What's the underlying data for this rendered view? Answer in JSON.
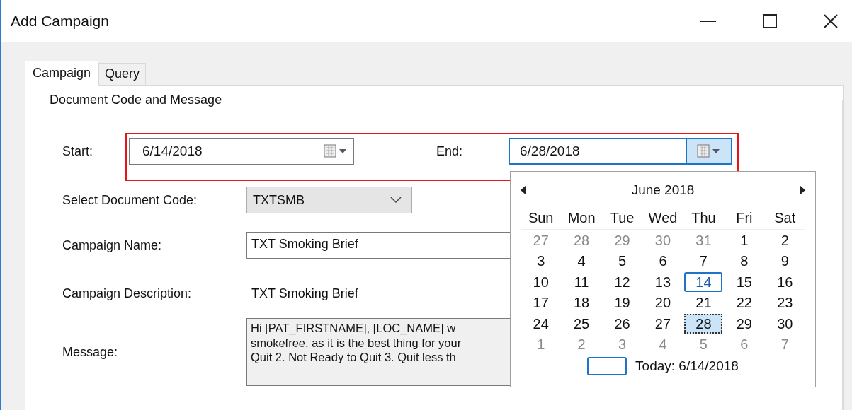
{
  "window": {
    "title": "Add Campaign"
  },
  "tabs": [
    {
      "label": "Campaign",
      "selected": true
    },
    {
      "label": "Query",
      "selected": false
    }
  ],
  "group": {
    "title": "Document Code and Message"
  },
  "start": {
    "label": "Start:",
    "value": "6/14/2018"
  },
  "end": {
    "label": "End:",
    "value": "6/28/2018",
    "dropdown_open": true
  },
  "document_code": {
    "label": "Select Document Code:",
    "value": "TXTSMB"
  },
  "campaign_name": {
    "label": "Campaign Name:",
    "value": "TXT Smoking Brief"
  },
  "campaign_description": {
    "label": "Campaign Description:",
    "value": "TXT Smoking Brief"
  },
  "message": {
    "label": "Message:",
    "lines": [
      "Hi [PAT_FIRSTNAME], [LOC_NAME] w",
      "smokefree, as it is the best thing for your",
      "Quit 2. Not Ready to Quit 3. Quit less th"
    ]
  },
  "calendar": {
    "month": "June 2018",
    "weekdays": [
      "Sun",
      "Mon",
      "Tue",
      "Wed",
      "Thu",
      "Fri",
      "Sat"
    ],
    "days": [
      {
        "label": "27",
        "other_month": true,
        "today": false,
        "selected": false
      },
      {
        "label": "28",
        "other_month": true,
        "today": false,
        "selected": false
      },
      {
        "label": "29",
        "other_month": true,
        "today": false,
        "selected": false
      },
      {
        "label": "30",
        "other_month": true,
        "today": false,
        "selected": false
      },
      {
        "label": "31",
        "other_month": true,
        "today": false,
        "selected": false
      },
      {
        "label": "1",
        "other_month": false,
        "today": false,
        "selected": false
      },
      {
        "label": "2",
        "other_month": false,
        "today": false,
        "selected": false
      },
      {
        "label": "3",
        "other_month": false,
        "today": false,
        "selected": false
      },
      {
        "label": "4",
        "other_month": false,
        "today": false,
        "selected": false
      },
      {
        "label": "5",
        "other_month": false,
        "today": false,
        "selected": false
      },
      {
        "label": "6",
        "other_month": false,
        "today": false,
        "selected": false
      },
      {
        "label": "7",
        "other_month": false,
        "today": false,
        "selected": false
      },
      {
        "label": "8",
        "other_month": false,
        "today": false,
        "selected": false
      },
      {
        "label": "9",
        "other_month": false,
        "today": false,
        "selected": false
      },
      {
        "label": "10",
        "other_month": false,
        "today": false,
        "selected": false
      },
      {
        "label": "11",
        "other_month": false,
        "today": false,
        "selected": false
      },
      {
        "label": "12",
        "other_month": false,
        "today": false,
        "selected": false
      },
      {
        "label": "13",
        "other_month": false,
        "today": false,
        "selected": false
      },
      {
        "label": "14",
        "other_month": false,
        "today": true,
        "selected": false
      },
      {
        "label": "15",
        "other_month": false,
        "today": false,
        "selected": false
      },
      {
        "label": "16",
        "other_month": false,
        "today": false,
        "selected": false
      },
      {
        "label": "17",
        "other_month": false,
        "today": false,
        "selected": false
      },
      {
        "label": "18",
        "other_month": false,
        "today": false,
        "selected": false
      },
      {
        "label": "19",
        "other_month": false,
        "today": false,
        "selected": false
      },
      {
        "label": "20",
        "other_month": false,
        "today": false,
        "selected": false
      },
      {
        "label": "21",
        "other_month": false,
        "today": false,
        "selected": false
      },
      {
        "label": "22",
        "other_month": false,
        "today": false,
        "selected": false
      },
      {
        "label": "23",
        "other_month": false,
        "today": false,
        "selected": false
      },
      {
        "label": "24",
        "other_month": false,
        "today": false,
        "selected": false
      },
      {
        "label": "25",
        "other_month": false,
        "today": false,
        "selected": false
      },
      {
        "label": "26",
        "other_month": false,
        "today": false,
        "selected": false
      },
      {
        "label": "27",
        "other_month": false,
        "today": false,
        "selected": false
      },
      {
        "label": "28",
        "other_month": false,
        "today": false,
        "selected": true
      },
      {
        "label": "29",
        "other_month": false,
        "today": false,
        "selected": false
      },
      {
        "label": "30",
        "other_month": false,
        "today": false,
        "selected": false
      },
      {
        "label": "1",
        "other_month": true,
        "today": false,
        "selected": false
      },
      {
        "label": "2",
        "other_month": true,
        "today": false,
        "selected": false
      },
      {
        "label": "3",
        "other_month": true,
        "today": false,
        "selected": false
      },
      {
        "label": "4",
        "other_month": true,
        "today": false,
        "selected": false
      },
      {
        "label": "5",
        "other_month": true,
        "today": false,
        "selected": false
      },
      {
        "label": "6",
        "other_month": true,
        "today": false,
        "selected": false
      },
      {
        "label": "7",
        "other_month": true,
        "today": false,
        "selected": false
      }
    ],
    "today_label": "Today: 6/14/2018"
  }
}
